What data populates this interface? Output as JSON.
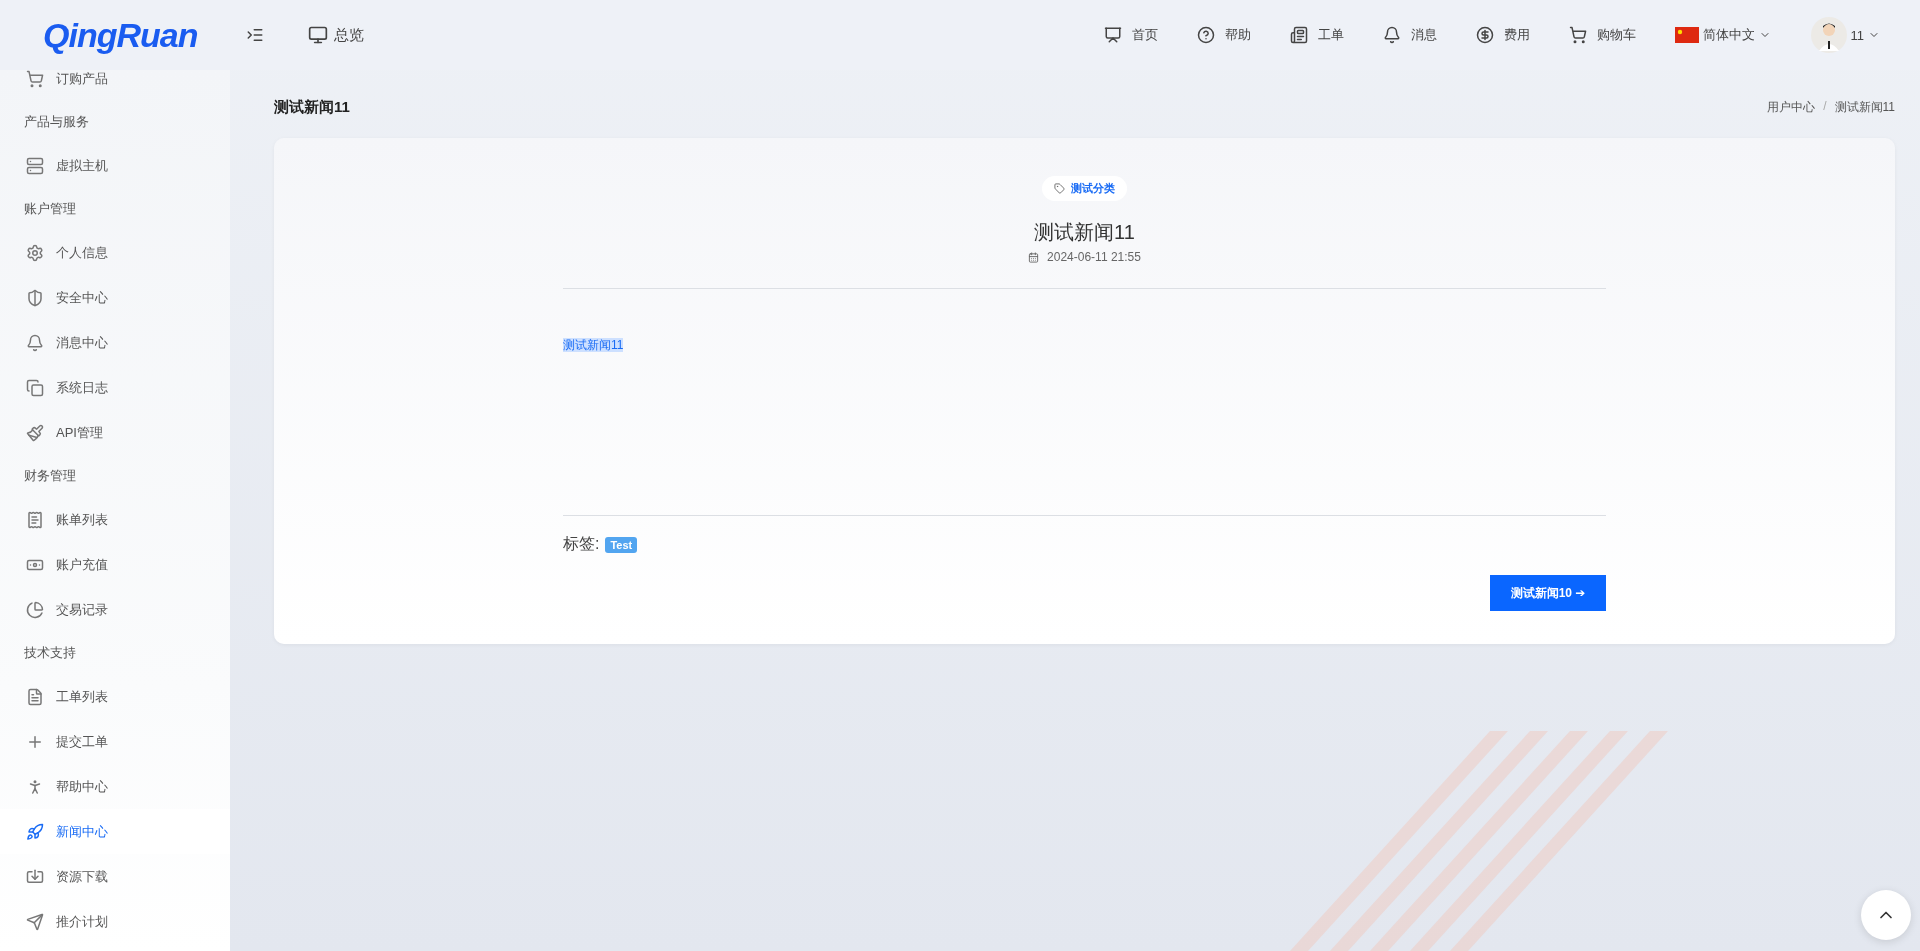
{
  "header": {
    "logo": "QingRuan",
    "overview": "总览",
    "nav": [
      {
        "label": "首页"
      },
      {
        "label": "帮助"
      },
      {
        "label": "工单"
      },
      {
        "label": "消息"
      },
      {
        "label": "费用"
      },
      {
        "label": "购物车"
      }
    ],
    "language": "简体中文",
    "user": "11"
  },
  "sidebar": {
    "items": [
      {
        "kind": "item",
        "label": "订购产品",
        "selected": false
      },
      {
        "kind": "group",
        "label": "产品与服务"
      },
      {
        "kind": "item",
        "label": "虚拟主机",
        "selected": false
      },
      {
        "kind": "group",
        "label": "账户管理"
      },
      {
        "kind": "item",
        "label": "个人信息",
        "selected": false
      },
      {
        "kind": "item",
        "label": "安全中心",
        "selected": false
      },
      {
        "kind": "item",
        "label": "消息中心",
        "selected": false
      },
      {
        "kind": "item",
        "label": "系统日志",
        "selected": false
      },
      {
        "kind": "item",
        "label": "API管理",
        "selected": false
      },
      {
        "kind": "group",
        "label": "财务管理"
      },
      {
        "kind": "item",
        "label": "账单列表",
        "selected": false
      },
      {
        "kind": "item",
        "label": "账户充值",
        "selected": false
      },
      {
        "kind": "item",
        "label": "交易记录",
        "selected": false
      },
      {
        "kind": "group",
        "label": "技术支持"
      },
      {
        "kind": "item",
        "label": "工单列表",
        "selected": false
      },
      {
        "kind": "item",
        "label": "提交工单",
        "selected": false
      },
      {
        "kind": "item",
        "label": "帮助中心",
        "selected": false
      },
      {
        "kind": "item",
        "label": "新闻中心",
        "selected": true
      },
      {
        "kind": "item",
        "label": "资源下载",
        "selected": false
      },
      {
        "kind": "item",
        "label": "推介计划",
        "selected": false
      }
    ]
  },
  "page": {
    "title": "测试新闻11",
    "breadcrumb": [
      "用户中心",
      "测试新闻11"
    ],
    "breadcrumb_separator": "/"
  },
  "article": {
    "category": "测试分类",
    "title": "测试新闻11",
    "date": "2024-06-11 21:55",
    "body": "测试新闻11",
    "tags_label": "标签:",
    "tags": [
      "Test"
    ],
    "next_button": "测试新闻10 ➔"
  }
}
